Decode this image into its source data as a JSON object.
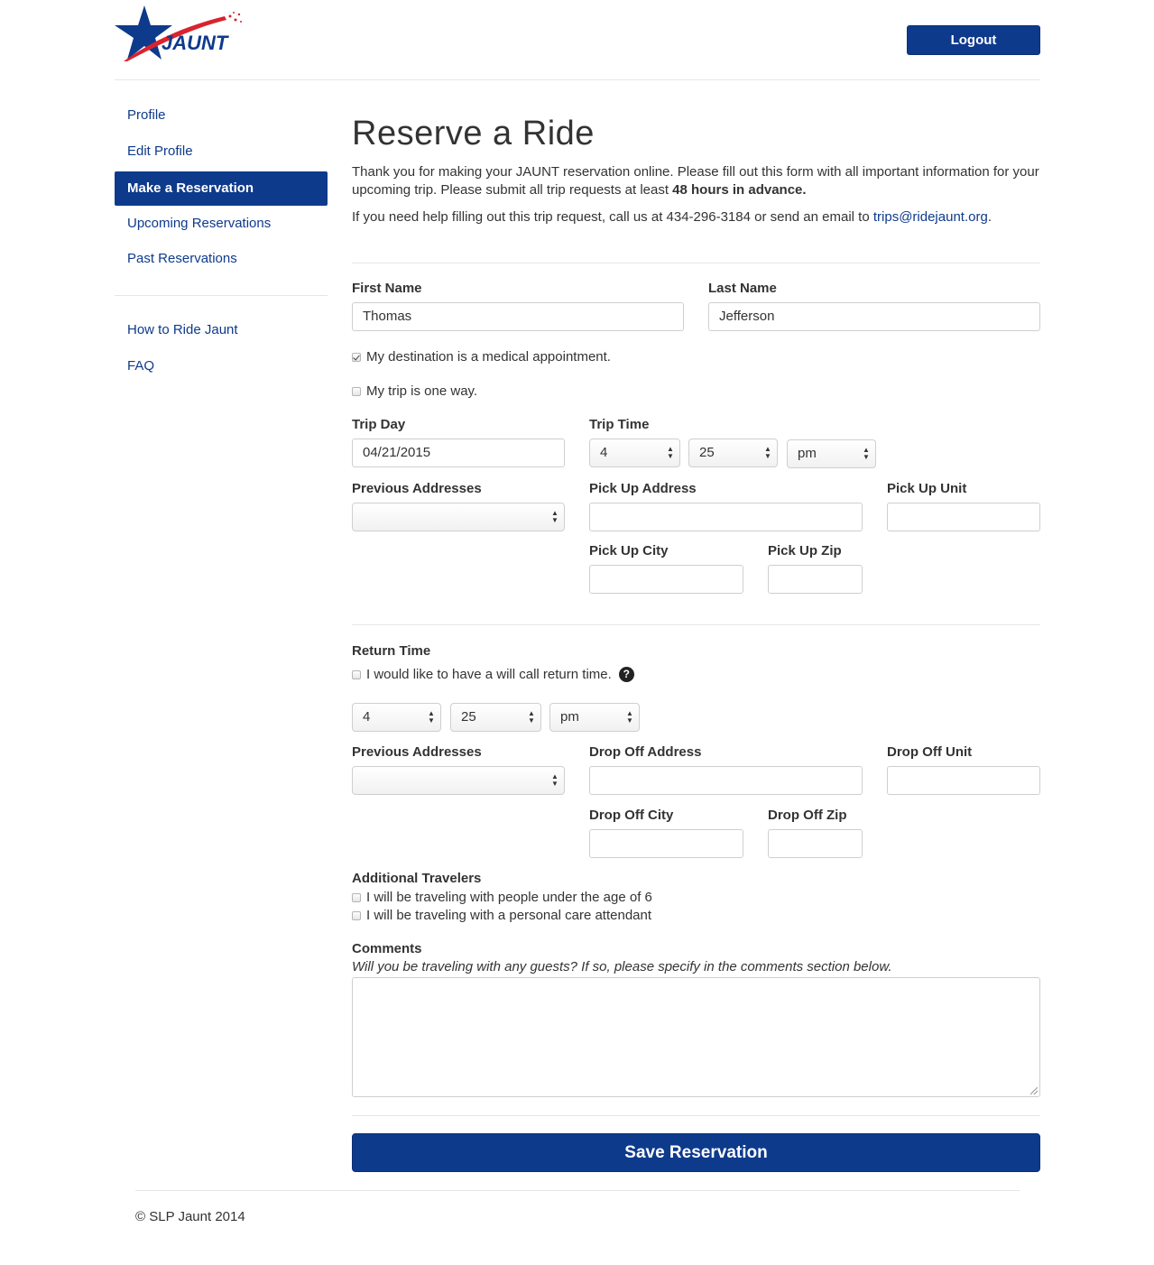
{
  "brand": {
    "logo_text": "JAUNT",
    "colors": {
      "primary": "#0e3a8c",
      "accent_red": "#d9232e"
    }
  },
  "header": {
    "logout_label": "Logout"
  },
  "sidebar": {
    "items": [
      {
        "label": "Profile",
        "active": false
      },
      {
        "label": "Edit Profile",
        "active": false
      },
      {
        "label": "Make a Reservation",
        "active": true
      },
      {
        "label": "Upcoming Reservations",
        "active": false
      },
      {
        "label": "Past Reservations",
        "active": false
      }
    ],
    "secondary_items": [
      {
        "label": "How to Ride Jaunt"
      },
      {
        "label": "FAQ"
      }
    ]
  },
  "main": {
    "title": "Reserve a Ride",
    "intro_text": "Thank you for making your JAUNT reservation online. Please fill out this form with all important information for your upcoming trip. Please submit all trip requests at least ",
    "intro_bold": "48 hours in advance.",
    "help_text": "If you need help filling out this trip request, call us at 434-296-3184 or send an email to ",
    "help_email": "trips@ridejaunt.org",
    "help_period": ".",
    "form": {
      "first_name_label": "First Name",
      "first_name_value": "Thomas",
      "last_name_label": "Last Name",
      "last_name_value": "Jefferson",
      "medical_label": "My destination is a medical appointment.",
      "medical_checked": true,
      "one_way_label": "My trip is one way.",
      "one_way_checked": false,
      "trip_day_label": "Trip Day",
      "trip_day_value": "04/21/2015",
      "trip_time_label": "Trip Time",
      "trip_time_hour": "4",
      "trip_time_minute": "25",
      "trip_time_ampm": "pm",
      "pickup_prev_label": "Previous Addresses",
      "pickup_address_label": "Pick Up Address",
      "pickup_unit_label": "Pick Up Unit",
      "pickup_city_label": "Pick Up City",
      "pickup_zip_label": "Pick Up Zip",
      "return_time_label": "Return Time",
      "will_call_label": "I would like to have a will call return time.",
      "will_call_help_icon": "?",
      "return_hour": "4",
      "return_minute": "25",
      "return_ampm": "pm",
      "dropoff_prev_label": "Previous Addresses",
      "dropoff_address_label": "Drop Off Address",
      "dropoff_unit_label": "Drop Off Unit",
      "dropoff_city_label": "Drop Off City",
      "dropoff_zip_label": "Drop Off Zip",
      "additional_travelers_label": "Additional Travelers",
      "under_six_label": "I will be traveling with people under the age of 6",
      "attendant_label": "I will be traveling with a personal care attendant",
      "comments_label": "Comments",
      "comments_hint": "Will you be traveling with any guests? If so, please specify in the comments section below.",
      "save_label": "Save Reservation"
    }
  },
  "footer": {
    "copyright": "© SLP Jaunt 2014"
  }
}
